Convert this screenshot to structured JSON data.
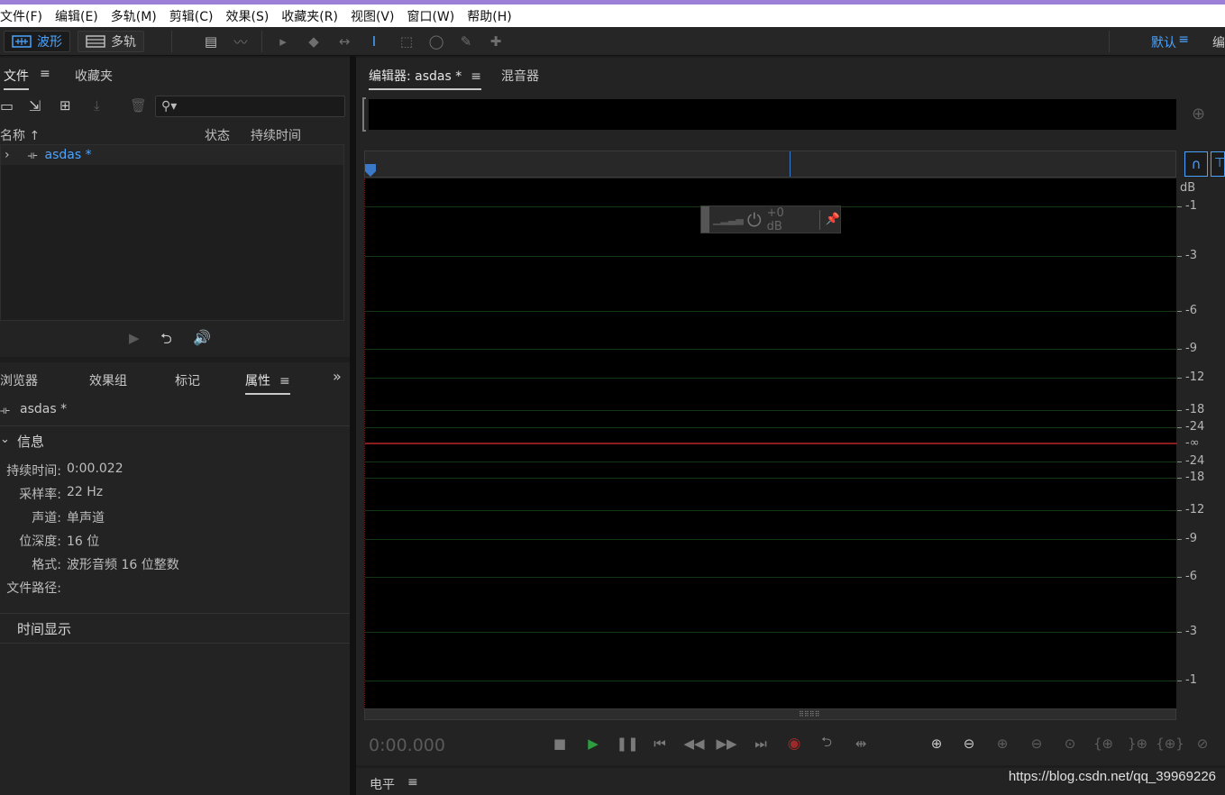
{
  "menu": [
    "文件(F)",
    "编辑(E)",
    "多轨(M)",
    "剪辑(C)",
    "效果(S)",
    "收藏夹(R)",
    "视图(V)",
    "窗口(W)",
    "帮助(H)"
  ],
  "toolbar": {
    "mode_waveform": "波形",
    "mode_multitrack": "多轨",
    "workspace": "默认",
    "workspace_menu": "≡",
    "edit_label": "编"
  },
  "files_panel": {
    "tab_files": "文件",
    "tab_favorites": "收藏夹",
    "col_name": "名称",
    "col_status": "状态",
    "col_duration": "持续时间",
    "search_glyph": "⚲▾",
    "file_name": "asdas *",
    "expand": "›"
  },
  "props_panel": {
    "tab_browser": "浏览器",
    "tab_effects": "效果组",
    "tab_markers": "标记",
    "tab_properties": "属性",
    "overflow": "»",
    "file_name": "asdas *",
    "section_info": "信息",
    "section_time": "时间显示",
    "rows": [
      {
        "label": "持续时间:",
        "value": "0:00.022"
      },
      {
        "label": "采样率:",
        "value": "22 Hz"
      },
      {
        "label": "声道:",
        "value": "单声道"
      },
      {
        "label": "位深度:",
        "value": "16 位"
      },
      {
        "label": "格式:",
        "value": "波形音频 16 位整数"
      },
      {
        "label": "文件路径:",
        "value": ""
      }
    ]
  },
  "editor": {
    "tab_editor": "编辑器: asdas *",
    "tab_mixer": "混音器",
    "hud_gain": "+0 dB",
    "time": "0:00.000",
    "db_unit": "dB",
    "db_labels_top": [
      "-1",
      "-3",
      "-6",
      "-9",
      "-12",
      "-18",
      "-24"
    ],
    "db_center": "-∞",
    "db_labels_bottom": [
      "-24",
      "-18",
      "-12",
      "-9",
      "-6",
      "-3",
      "-1"
    ]
  },
  "level_panel": {
    "title": "电平"
  },
  "watermark": "https://blog.csdn.net/qq_39969226",
  "colors": {
    "accent_blue": "#4aa4ff",
    "center_line": "#8a1d1d",
    "grid_green": "#133813",
    "menu_strip": "#9c7fd6"
  }
}
